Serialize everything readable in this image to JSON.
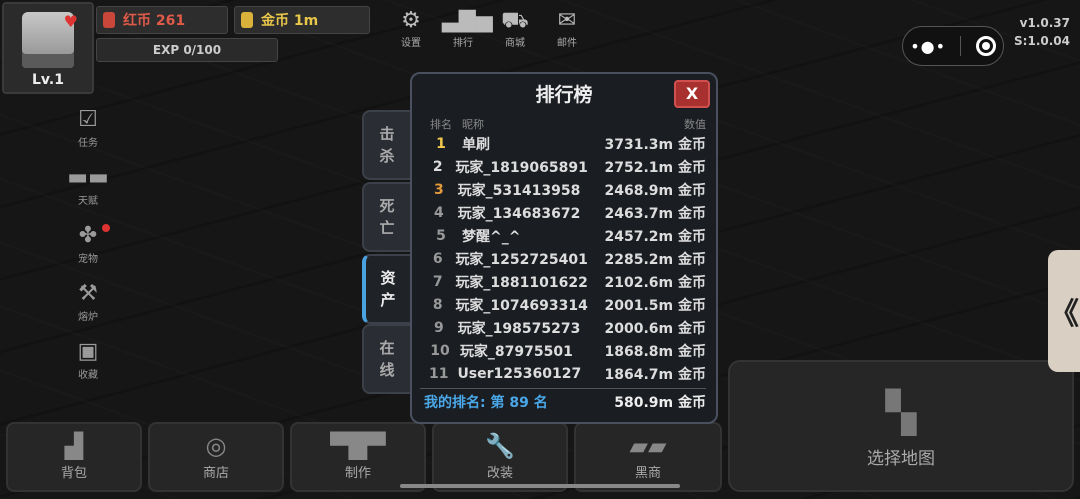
{
  "player": {
    "level": "Lv.1",
    "red_currency": "红币 261",
    "gold_currency": "金币 1m",
    "exp": "EXP 0/100"
  },
  "top_menu": [
    {
      "label": "设置",
      "icon": "gear-icon"
    },
    {
      "label": "排行",
      "icon": "podium-icon"
    },
    {
      "label": "商城",
      "icon": "cart-icon"
    },
    {
      "label": "邮件",
      "icon": "mail-icon"
    }
  ],
  "version": {
    "client": "v1.0.37",
    "server": "S:1.0.04"
  },
  "side_menu": [
    {
      "label": "任务",
      "icon": "clipboard-check-icon"
    },
    {
      "label": "天赋",
      "icon": "dumbbell-icon"
    },
    {
      "label": "宠物",
      "icon": "paw-icon"
    },
    {
      "label": "熔炉",
      "icon": "hammer-icon"
    },
    {
      "label": "收藏",
      "icon": "collection-icon"
    }
  ],
  "bottom_menu": [
    {
      "label": "背包",
      "icon": "backpack-icon"
    },
    {
      "label": "商店",
      "icon": "coins-icon"
    },
    {
      "label": "制作",
      "icon": "anvil-icon"
    },
    {
      "label": "改装",
      "icon": "wrench-icon"
    },
    {
      "label": "黑商",
      "icon": "ingots-icon"
    }
  ],
  "map_button": {
    "label": "选择地图",
    "icon": "map-icon"
  },
  "leaderboard": {
    "title": "排行榜",
    "close_label": "X",
    "tabs": [
      {
        "label_1": "击",
        "label_2": "杀"
      },
      {
        "label_1": "死",
        "label_2": "亡"
      },
      {
        "label_1": "资",
        "label_2": "产"
      },
      {
        "label_1": "在",
        "label_2": "线"
      }
    ],
    "active_tab": "资产",
    "columns": {
      "rank": "排名",
      "name": "昵称",
      "value": "数值"
    },
    "rows": [
      {
        "rank": "1",
        "name": "单刷",
        "value": "3731.3m 金币"
      },
      {
        "rank": "2",
        "name": "玩家_1819065891",
        "value": "2752.1m 金币"
      },
      {
        "rank": "3",
        "name": "玩家_531413958",
        "value": "2468.9m 金币"
      },
      {
        "rank": "4",
        "name": "玩家_134683672",
        "value": "2463.7m 金币"
      },
      {
        "rank": "5",
        "name": "梦醒^_^",
        "value": "2457.2m 金币"
      },
      {
        "rank": "6",
        "name": "玩家_1252725401",
        "value": "2285.2m 金币"
      },
      {
        "rank": "7",
        "name": "玩家_1881101622",
        "value": "2102.6m 金币"
      },
      {
        "rank": "8",
        "name": "玩家_1074693314",
        "value": "2001.5m 金币"
      },
      {
        "rank": "9",
        "name": "玩家_198575273",
        "value": "2000.6m 金币"
      },
      {
        "rank": "10",
        "name": "玩家_87975501",
        "value": "1868.8m 金币"
      },
      {
        "rank": "11",
        "name": "User125360127",
        "value": "1864.7m 金币"
      }
    ],
    "my_rank": "我的排名: 第 89 名",
    "my_value": "580.9m 金币"
  },
  "edge_tab": {
    "label": "《"
  },
  "colors": {
    "accent_blue": "#4aa8e8",
    "gold": "#f2c94c",
    "bronze": "#e39a3c",
    "close_red": "#a8302f"
  }
}
